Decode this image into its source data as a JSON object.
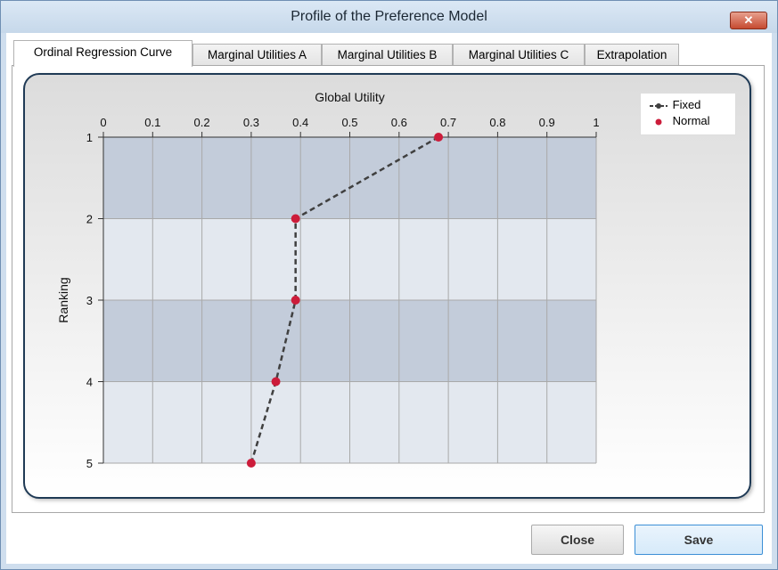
{
  "window": {
    "title": "Profile of the Preference Model",
    "close_glyph": "✕"
  },
  "tabs": [
    {
      "label": "Ordinal Regression Curve",
      "active": true
    },
    {
      "label": "Marginal Utilities A",
      "active": false
    },
    {
      "label": "Marginal Utilities B",
      "active": false
    },
    {
      "label": "Marginal Utilities C",
      "active": false
    },
    {
      "label": "Extrapolation",
      "active": false
    }
  ],
  "buttons": {
    "close": "Close",
    "save": "Save"
  },
  "legend": {
    "fixed": "Fixed",
    "normal": "Normal"
  },
  "colors": {
    "band_dark": "#c3ccda",
    "band_light": "#e3e8ef",
    "line": "#404040",
    "point": "#cc1c3a",
    "frame": "#1f3a55"
  },
  "chart_data": {
    "type": "line",
    "title": "",
    "xlabel": "Global Utility",
    "ylabel": "Ranking",
    "x_axis_position": "top",
    "xlim": [
      0,
      1
    ],
    "ylim": [
      1,
      5
    ],
    "y_inverted": true,
    "x_ticks": [
      "0",
      "0.1",
      "0.2",
      "0.3",
      "0.4",
      "0.5",
      "0.6",
      "0.7",
      "0.8",
      "0.9",
      "1"
    ],
    "y_ticks": [
      "1",
      "2",
      "3",
      "4",
      "5"
    ],
    "grid": true,
    "legend_position": "top-right",
    "series": [
      {
        "name": "Fixed",
        "style": "dashed-line",
        "points": [
          {
            "x": 0.68,
            "y": 1
          },
          {
            "x": 0.39,
            "y": 2
          },
          {
            "x": 0.39,
            "y": 3
          },
          {
            "x": 0.35,
            "y": 4
          },
          {
            "x": 0.3,
            "y": 5
          }
        ]
      },
      {
        "name": "Normal",
        "style": "markers",
        "points": [
          {
            "x": 0.68,
            "y": 1
          },
          {
            "x": 0.39,
            "y": 2
          },
          {
            "x": 0.39,
            "y": 3
          },
          {
            "x": 0.35,
            "y": 4
          },
          {
            "x": 0.3,
            "y": 5
          }
        ]
      }
    ]
  }
}
